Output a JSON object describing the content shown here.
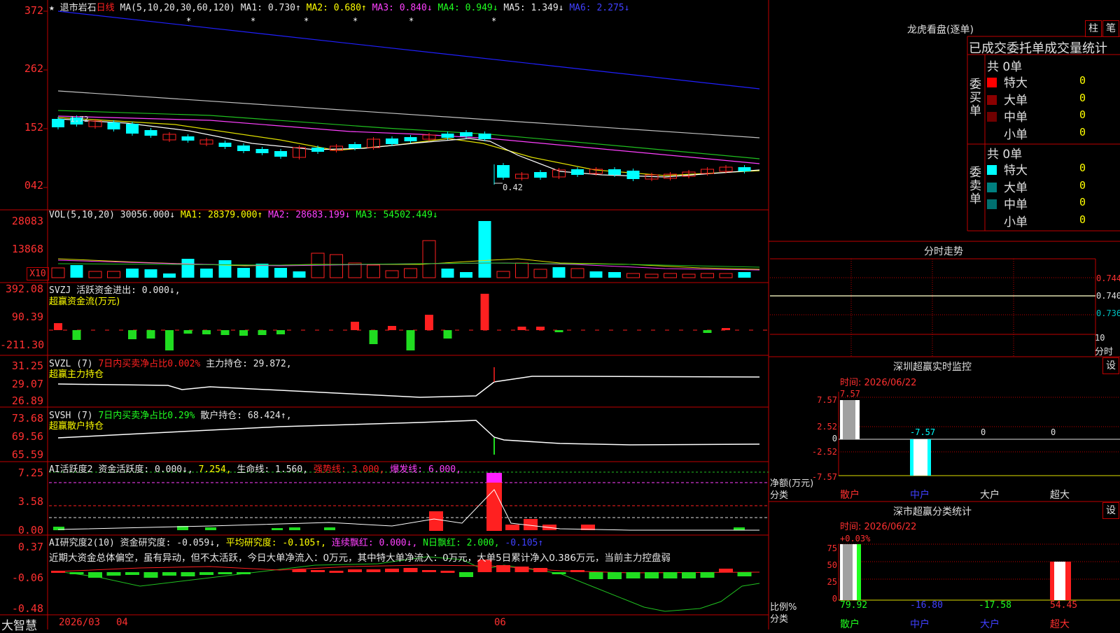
{
  "app": {
    "name": "大智慧"
  },
  "main_chart": {
    "star": "★",
    "stock_name": "退市岩石",
    "period": "日线",
    "ma_label": "MA(5,10,20,30,60,120)",
    "ma1": "MA1: 0.730↑",
    "ma2": "MA2: 0.680↑",
    "ma3": "MA3: 0.840↓",
    "ma4": "MA4: 0.949↓",
    "ma5": "MA5: 1.349↓",
    "ma6": "MA6: 2.275↓",
    "y_labels": [
      "372",
      "262",
      "152",
      "042"
    ],
    "low_marker": "0.42",
    "high_marker": "1.72"
  },
  "vol": {
    "label": "VOL(5,10,20)",
    "value": "30056.000↓",
    "ma1": "MA1: 28379.000↑",
    "ma2": "MA2: 28683.199↓",
    "ma3": "MA3: 54502.449↓",
    "y_labels": [
      "28083",
      "13868"
    ],
    "unit": "X10"
  },
  "svzj": {
    "label": "SVZJ",
    "text": "活跃资金进出: 0.000↓,",
    "sub": "超赢资金流(万元)",
    "y_labels": [
      "392.08",
      "90.39",
      "-211.30"
    ]
  },
  "svzl": {
    "label": "SVZL (7)",
    "pct": "7日内买卖净占比0.002%",
    "text": "主力持仓: 29.872,",
    "sub": "超赢主力持仓",
    "y_labels": [
      "31.25",
      "29.07",
      "26.89"
    ]
  },
  "svsh": {
    "label": "SVSH (7)",
    "pct": "7日内买卖净占比0.29%",
    "text": "散户持仓: 68.424↑,",
    "sub": "超赢散户持仓",
    "y_labels": [
      "73.68",
      "69.56",
      "65.59"
    ]
  },
  "ai_active": {
    "label": "AI活跃度2",
    "text": "资金活跃度: 0.000↓,",
    "v1": "7.254,",
    "life": "生命线: 1.560,",
    "strong": "强势线: 3.000,",
    "burst": "爆发线: 6.000,",
    "y_labels": [
      "7.25",
      "3.58",
      "0.00"
    ]
  },
  "ai_research": {
    "label": "AI研究度2(10)",
    "text": "资金研究度: -0.059↓,",
    "avg": "平均研究度: -0.105↑,",
    "cont": "连续飘红: 0.000↓,",
    "nday": "N日飘红: 2.000,",
    "tail": "-0.105↑",
    "comment": "近期大资金总体偏空，虽有异动，但不太活跃，今日大单净流入：0万元，其中特大单净流入：0万元，大单5日累计净入0.386万元，当前主力控盘弱",
    "y_labels": [
      "0.37",
      "-0.06",
      "-0.48"
    ]
  },
  "x_axis": {
    "labels": [
      "2026/03",
      "04",
      "06"
    ]
  },
  "right": {
    "lhb_title": "龙虎看盘(逐单)",
    "btn_col": "柱",
    "btn_bi": "笔",
    "stats_header": "已成交委托单成交量统计",
    "buy": {
      "side": "委买单",
      "total": "共 0单",
      "rows": [
        {
          "label": "特大",
          "value": "0",
          "color": "#ff0000"
        },
        {
          "label": "大单",
          "value": "0",
          "color": "#8b0000"
        },
        {
          "label": "中单",
          "value": "0",
          "color": "#700000"
        },
        {
          "label": "小单",
          "value": "0",
          "color": "#000000"
        }
      ]
    },
    "sell": {
      "side": "委卖单",
      "total": "共 0单",
      "rows": [
        {
          "label": "特大",
          "value": "0",
          "color": "#00ffff"
        },
        {
          "label": "大单",
          "value": "0",
          "color": "#008080"
        },
        {
          "label": "中单",
          "value": "0",
          "color": "#007070"
        },
        {
          "label": "小单",
          "value": "0",
          "color": "#000000"
        }
      ]
    },
    "intraday": {
      "title": "分时走势",
      "y_labels": [
        "0.744",
        "0.740",
        "0.736"
      ],
      "x_label_1": "10",
      "x_label_2": "分时"
    },
    "sz_monitor": {
      "title": "深圳超赢实时监控",
      "btn": "设",
      "time": "时间: 2026/06/22",
      "y_labels": [
        "7.57",
        "2.52",
        "0",
        "-2.52",
        "-7.57"
      ],
      "top_val": "7.57",
      "bar_vals": [
        "-7.57",
        "0",
        "0"
      ],
      "ylabel": "净额(万元)",
      "xlabel": "分类",
      "cats": [
        "散户",
        "中户",
        "大户",
        "超大"
      ]
    },
    "sz_class": {
      "title": "深市超赢分类统计",
      "btn": "设",
      "time": "时间: 2026/06/22",
      "top_val": "+0.03%",
      "y_labels": [
        "75",
        "50",
        "25",
        "0"
      ],
      "bar_vals": [
        "79.92",
        "-16.80",
        "-17.58",
        "54.45"
      ],
      "ylabel": "比例%",
      "xlabel": "分类",
      "cats": [
        "散户",
        "中户",
        "大户",
        "超大"
      ]
    }
  }
}
